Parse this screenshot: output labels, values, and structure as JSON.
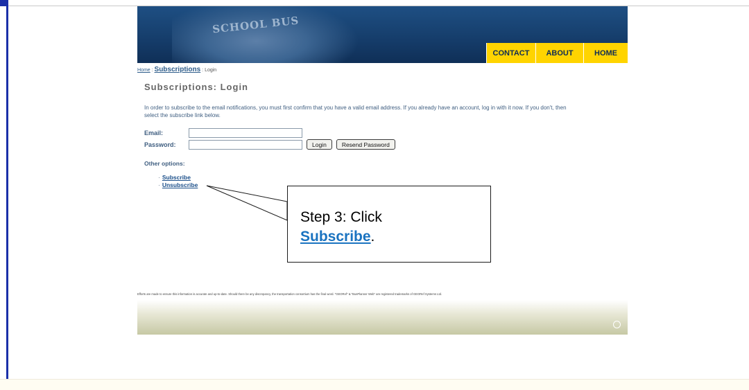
{
  "header": {
    "image_text": "SCHOOL BUS",
    "nav": [
      "CONTACT",
      "ABOUT",
      "HOME"
    ]
  },
  "breadcrumb": {
    "home": "Home",
    "sep1": " : ",
    "subscriptions": "Subscriptions",
    "sep2": " : ",
    "current": "Login"
  },
  "page_title": "Subscriptions: Login",
  "intro": "In order to subscribe to the email notifications, you must first confirm that you have a valid email address. If you already have an account, log in with it now. If you don't, then select the subscribe link below.",
  "form": {
    "email_label": "Email:",
    "email_value": "",
    "password_label": "Password:",
    "password_value": "",
    "login_button": "Login",
    "resend_button": "Resend Password"
  },
  "other_options": {
    "heading": "Other options:",
    "bullet": "·",
    "links": [
      "Subscribe",
      "Unsubscribe"
    ]
  },
  "disclaimer": "Efforts are made to ensure this information is accurate and up-to-date. Should there be any discrepancy, the transportation consortium has the final word. \"GEORef\" & \"BusPlanner Web\" are registered trademarks of GEORef Systems Ltd.",
  "callout": {
    "line1": "Step 3:  Click",
    "link": "Subscribe",
    "tail": "."
  },
  "colors": {
    "header_blue": "#1e4f83",
    "nav_yellow": "#ffd400",
    "link_blue": "#1b4f8a",
    "callout_link": "#1a73c0"
  }
}
